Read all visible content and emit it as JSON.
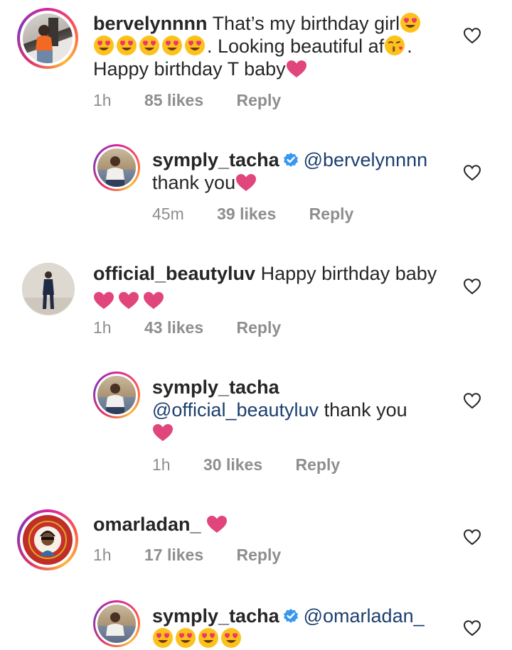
{
  "comments": [
    {
      "username": "bervelynnnn",
      "text_line1": "That’s my birthday girl",
      "text_line2": ". Looking beautiful af",
      "text_line2_end": ".",
      "text_line3": "Happy birthday T baby",
      "time": "1h",
      "likes": "85 likes",
      "reply": "Reply",
      "heart_eyes_count": 6
    },
    {
      "username": "symply_tacha",
      "mention": "@bervelynnnn",
      "text_line2": "thank you",
      "time": "45m",
      "likes": "39 likes",
      "reply": "Reply",
      "verified": true
    },
    {
      "username": "official_beautyluv",
      "text_line1": "Happy birthday baby",
      "time": "1h",
      "likes": "43 likes",
      "reply": "Reply",
      "hearts_count": 3
    },
    {
      "username": "symply_tacha",
      "mention": "@official_beautyluv",
      "text_after_mention": " thank you",
      "time": "1h",
      "likes": "30 likes",
      "reply": "Reply"
    },
    {
      "username": "omarladan_",
      "time": "1h",
      "likes": "17 likes",
      "reply": "Reply"
    },
    {
      "username": "symply_tacha",
      "mention": "@omarladan_",
      "verified": true
    }
  ],
  "icons": {
    "like": "heart-outline-icon",
    "verified": "verified-badge-icon",
    "heart_emoji": "heart-emoji",
    "heart_eyes": "heart-eyes-emoji",
    "kiss": "kissing-heart-emoji"
  },
  "colors": {
    "text": "#262626",
    "meta": "#8e8e8e",
    "mention": "#1c3f6e",
    "heart": "#e0457b",
    "verified": "#3897f0"
  }
}
